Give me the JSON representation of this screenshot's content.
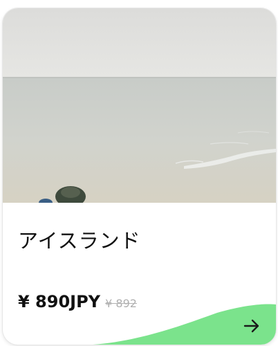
{
  "card": {
    "title": "アイスランド",
    "price": "¥ 890JPY",
    "original_price": "¥ 892",
    "action_icon": "arrow-right-icon",
    "accent_color": "#7be38c"
  }
}
